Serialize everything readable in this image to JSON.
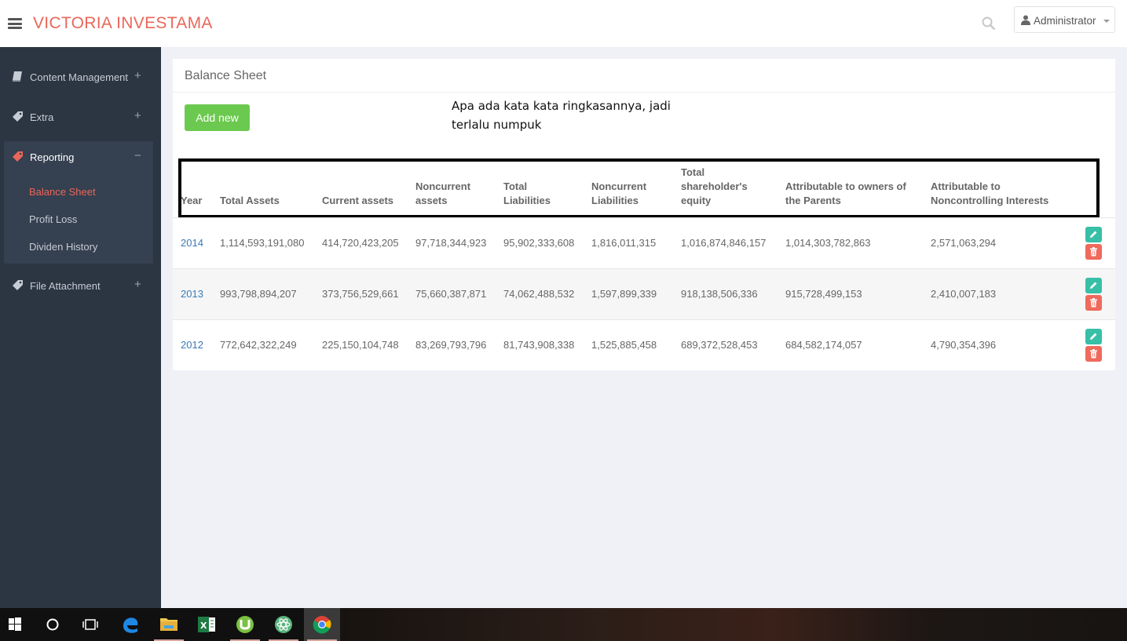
{
  "header": {
    "brand": "VICTORIA INVESTAMA",
    "user_label": "Administrator"
  },
  "sidebar": {
    "items": [
      {
        "label": "Content Management",
        "toggle": "+",
        "icon": "book-icon"
      },
      {
        "label": "Extra",
        "toggle": "+",
        "icon": "tag-icon"
      },
      {
        "label": "Reporting",
        "toggle": "−",
        "icon": "tag-icon"
      },
      {
        "label": "File Attachment",
        "toggle": "+",
        "icon": "tag-icon"
      }
    ],
    "reporting_sub": [
      "Balance Sheet",
      "Profit Loss",
      "Dividen History"
    ]
  },
  "panel": {
    "title": "Balance Sheet",
    "add_label": "Add new",
    "annotation_line1": "Apa ada kata kata ringkasannya, jadi",
    "annotation_line2": "terlalu numpuk"
  },
  "table": {
    "headers": [
      [
        "Year"
      ],
      [
        "Total Assets"
      ],
      [
        "Current assets"
      ],
      [
        "Noncurrent",
        "assets"
      ],
      [
        "Total",
        "Liabilities"
      ],
      [
        "Noncurrent",
        "Liabilities"
      ],
      [
        "Total",
        "shareholder's",
        "equity"
      ],
      [
        "Attributable to owners of",
        "the Parents"
      ],
      [
        "Attributable to",
        "Noncontrolling Interests"
      ]
    ],
    "rows": [
      [
        "2014",
        "1,114,593,191,080",
        "414,720,423,205",
        "97,718,344,923",
        "95,902,333,608",
        "1,816,011,315",
        "1,016,874,846,157",
        "1,014,303,782,863",
        "2,571,063,294"
      ],
      [
        "2013",
        "993,798,894,207",
        "373,756,529,661",
        "75,660,387,871",
        "74,062,488,532",
        "1,597,899,339",
        "918,138,506,336",
        "915,728,499,153",
        "2,410,007,183"
      ],
      [
        "2012",
        "772,642,322,249",
        "225,150,104,748",
        "83,269,793,796",
        "81,743,908,338",
        "1,525,885,458",
        "689,372,528,453",
        "684,582,174,057",
        "4,790,354,396"
      ]
    ]
  },
  "colors": {
    "brand": "#e9675a",
    "sidebar_bg": "#2c3542",
    "add_button": "#6cc94f",
    "edit_button": "#37bfa7",
    "delete_button": "#ef6a5c",
    "year_link": "#3a7ab8"
  },
  "taskbar": {
    "icons": [
      "windows-start-icon",
      "cortana-icon",
      "task-view-icon",
      "edge-icon",
      "file-explorer-icon",
      "excel-icon",
      "utorrent-icon",
      "atom-icon",
      "chrome-icon"
    ]
  }
}
